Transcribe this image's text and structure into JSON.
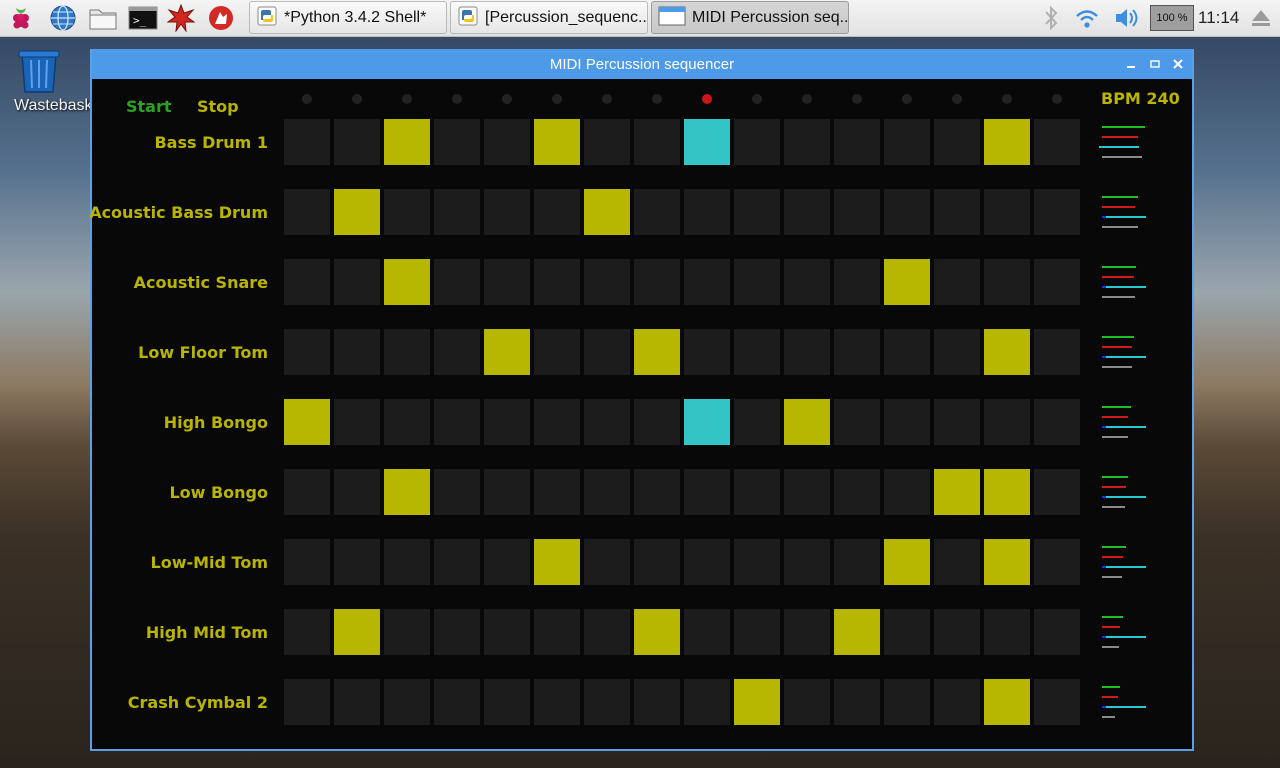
{
  "taskbar": {
    "tasks": [
      {
        "label": "*Python 3.4.2 Shell*",
        "active": false
      },
      {
        "label": "[Percussion_sequenc...",
        "active": false
      },
      {
        "label": "MIDI Percussion seq...",
        "active": true
      }
    ],
    "cpu": "100 %",
    "cpu_value": 1.0,
    "clock": "11:14"
  },
  "desktop": {
    "wastebasket_label": "Wastebask"
  },
  "window": {
    "title": "MIDI Percussion sequencer",
    "start_label": "Start",
    "stop_label": "Stop",
    "bpm_label": "BPM 240",
    "current_step": 8,
    "colors": {
      "active": "#b7b600",
      "playhead": "#33c5c5",
      "inactive": "#1c1c1c",
      "led_on": "#c8161a"
    },
    "rows": [
      {
        "name": "Bass Drum 1",
        "steps": [
          0,
          0,
          1,
          0,
          0,
          1,
          0,
          0,
          1,
          0,
          0,
          0,
          0,
          0,
          1,
          0
        ],
        "levels": [
          0.65,
          0.55,
          0.5,
          0.6
        ]
      },
      {
        "name": "Acoustic Bass Drum",
        "steps": [
          0,
          1,
          0,
          0,
          0,
          0,
          1,
          0,
          0,
          0,
          0,
          0,
          0,
          0,
          0,
          0
        ],
        "levels": [
          0.55,
          0.5,
          0.6,
          0.55
        ]
      },
      {
        "name": "Acoustic Snare",
        "steps": [
          0,
          0,
          1,
          0,
          0,
          0,
          0,
          0,
          0,
          0,
          0,
          0,
          1,
          0,
          0,
          0
        ],
        "levels": [
          0.52,
          0.48,
          0.6,
          0.5
        ]
      },
      {
        "name": "Low Floor Tom",
        "steps": [
          0,
          0,
          0,
          0,
          1,
          0,
          0,
          1,
          0,
          0,
          0,
          0,
          0,
          0,
          1,
          0
        ],
        "levels": [
          0.48,
          0.45,
          0.6,
          0.45
        ]
      },
      {
        "name": "High Bongo",
        "steps": [
          1,
          0,
          0,
          0,
          0,
          0,
          0,
          0,
          1,
          0,
          1,
          0,
          0,
          0,
          0,
          0
        ],
        "levels": [
          0.44,
          0.4,
          0.6,
          0.4
        ]
      },
      {
        "name": "Low Bongo",
        "steps": [
          0,
          0,
          1,
          0,
          0,
          0,
          0,
          0,
          0,
          0,
          0,
          0,
          0,
          1,
          1,
          0
        ],
        "levels": [
          0.4,
          0.36,
          0.6,
          0.35
        ]
      },
      {
        "name": "Low-Mid Tom",
        "steps": [
          0,
          0,
          0,
          0,
          0,
          1,
          0,
          0,
          0,
          0,
          0,
          0,
          1,
          0,
          1,
          0
        ],
        "levels": [
          0.36,
          0.32,
          0.6,
          0.3
        ]
      },
      {
        "name": "High Mid Tom",
        "steps": [
          0,
          1,
          0,
          0,
          0,
          0,
          0,
          1,
          0,
          0,
          0,
          1,
          0,
          0,
          0,
          0
        ],
        "levels": [
          0.32,
          0.28,
          0.6,
          0.25
        ]
      },
      {
        "name": "Crash Cymbal 2",
        "steps": [
          0,
          0,
          0,
          0,
          0,
          0,
          0,
          0,
          0,
          1,
          0,
          0,
          0,
          0,
          1,
          0
        ],
        "levels": [
          0.28,
          0.24,
          0.6,
          0.2
        ]
      }
    ]
  }
}
